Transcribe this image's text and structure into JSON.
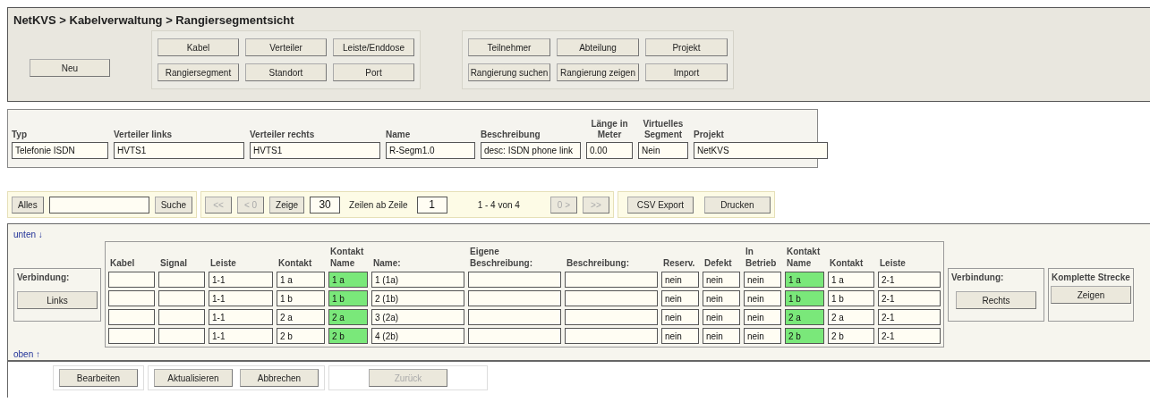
{
  "title": "NetKVS > Kabelverwaltung > Rangiersegmentsicht",
  "nav": {
    "new_button": "Neu",
    "groups": [
      {
        "buttons": [
          "Kabel",
          "Verteiler",
          "Leiste/Enddose",
          "Rangiersegment",
          "Standort",
          "Port"
        ]
      },
      {
        "buttons": [
          "Teilnehmer",
          "Abteilung",
          "Projekt",
          "Rangierung suchen",
          "Rangierung zeigen",
          "Import"
        ]
      }
    ]
  },
  "segment": {
    "fields": [
      {
        "label": "Typ",
        "value": "Telefonie ISDN"
      },
      {
        "label": "Verteiler links",
        "value": "HVTS1"
      },
      {
        "label": "Verteiler rechts",
        "value": "HVTS1"
      },
      {
        "label": "Name",
        "value": "R-Segm1.0"
      },
      {
        "label": "Beschreibung",
        "value": "desc: ISDN phone link"
      },
      {
        "label": "Länge in Meter",
        "value": "0.00"
      },
      {
        "label": "Virtuelles Segment",
        "value": "Nein"
      },
      {
        "label": "Projekt",
        "value": "NetKVS"
      }
    ]
  },
  "toolbar": {
    "all_button": "Alles",
    "search_button": "Suche",
    "paging": [
      {
        "label": "<<",
        "disabled": true
      },
      {
        "label": "< 0",
        "disabled": true
      }
    ],
    "show_button": "Zeige",
    "rows_value": "30",
    "rows_label": "Zeilen ab Zeile",
    "start_value": "1",
    "range": "1 - 4 von 4",
    "paging_next": [
      {
        "label": "0 >",
        "disabled": true
      },
      {
        "label": ">>",
        "disabled": true
      }
    ],
    "export_buttons": [
      "CSV Export",
      "Drucken"
    ]
  },
  "links": {
    "down": "unten ↓",
    "up": "oben ↑"
  },
  "left_connection": {
    "label": "Verbindung:",
    "button": "Links"
  },
  "right_connection": {
    "label": "Verbindung:",
    "button": "Rechts"
  },
  "route": {
    "label": "Komplette Strecke",
    "button": "Zeigen"
  },
  "table": {
    "columns": [
      {
        "label": "Kabel",
        "highlighted": false
      },
      {
        "label": "Signal",
        "highlighted": false
      },
      {
        "label": "Leiste",
        "highlighted": false
      },
      {
        "label": "Kontakt",
        "highlighted": false
      },
      {
        "label": "Kontakt Name",
        "highlighted": true
      },
      {
        "label": "Name:",
        "highlighted": false
      },
      {
        "label": "Eigene Beschreibung:",
        "highlighted": false
      },
      {
        "label": "Beschreibung:",
        "highlighted": false
      },
      {
        "label": "Reserv.",
        "highlighted": false
      },
      {
        "label": "Defekt",
        "highlighted": false
      },
      {
        "label": "In Betrieb",
        "highlighted": false
      },
      {
        "label": "Kontakt Name",
        "highlighted": true
      },
      {
        "label": "Kontakt",
        "highlighted": false
      },
      {
        "label": "Leiste",
        "highlighted": false
      }
    ],
    "rows": [
      {
        "left": [
          "1-1",
          "1 a",
          "1 a",
          "1 (1a)"
        ],
        "flags": [
          "nein",
          "nein",
          "nein"
        ],
        "right": [
          "1 a",
          "1 a",
          "2-1"
        ]
      },
      {
        "left": [
          "1-1",
          "1 b",
          "1 b",
          "2 (1b)"
        ],
        "flags": [
          "nein",
          "nein",
          "nein"
        ],
        "right": [
          "1 b",
          "1 b",
          "2-1"
        ]
      },
      {
        "left": [
          "1-1",
          "2 a",
          "2 a",
          "3 (2a)"
        ],
        "flags": [
          "nein",
          "nein",
          "nein"
        ],
        "right": [
          "2 a",
          "2 a",
          "2-1"
        ]
      },
      {
        "left": [
          "1-1",
          "2 b",
          "2 b",
          "4 (2b)"
        ],
        "flags": [
          "nein",
          "nein",
          "nein"
        ],
        "right": [
          "2 b",
          "2 b",
          "2-1"
        ]
      }
    ]
  },
  "actions": [
    {
      "buttons": [
        {
          "label": "Bearbeiten",
          "disabled": false
        }
      ]
    },
    {
      "buttons": [
        {
          "label": "Aktualisieren",
          "disabled": false
        },
        {
          "label": "Abbrechen",
          "disabled": false
        }
      ]
    },
    {
      "buttons": [
        {
          "label": "Zurück",
          "disabled": true
        }
      ]
    }
  ]
}
